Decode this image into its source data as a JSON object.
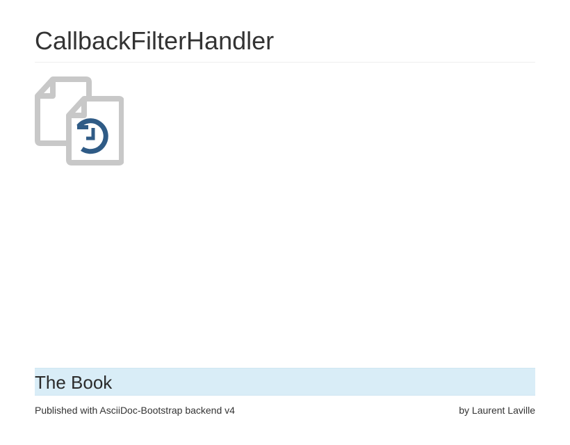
{
  "header": {
    "title": "CallbackFilterHandler"
  },
  "icon": {
    "name": "documents-sync-icon",
    "outline_color": "#c8c8c8",
    "accent_color": "#2f5b86"
  },
  "banner": {
    "label": "The Book",
    "background": "#d9edf7"
  },
  "footer": {
    "published_text": "Published with AsciiDoc-Bootstrap backend v4",
    "author_text": "by Laurent Laville"
  }
}
